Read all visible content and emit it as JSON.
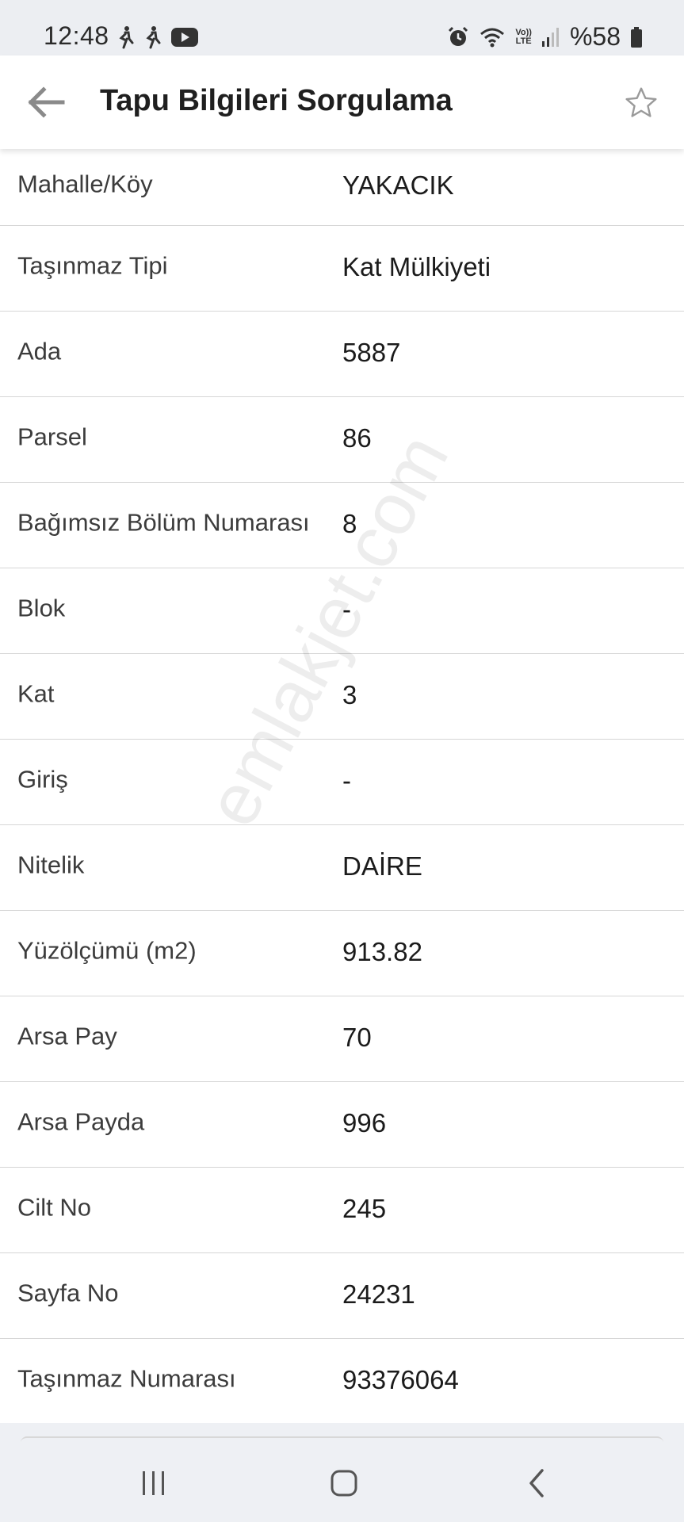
{
  "status_bar": {
    "time": "12:48",
    "battery_percent": "%58",
    "volte_top": "Vo))",
    "volte_bottom": "LTE"
  },
  "app_bar": {
    "title": "Tapu Bilgileri Sorgulama",
    "back_icon": "arrow-left-icon",
    "favorite_icon": "star-outline-icon"
  },
  "rows": [
    {
      "label": "Mahalle/Köy",
      "value": "YAKACIK"
    },
    {
      "label": "Taşınmaz Tipi",
      "value": "Kat Mülkiyeti"
    },
    {
      "label": "Ada",
      "value": "5887"
    },
    {
      "label": "Parsel",
      "value": "86"
    },
    {
      "label": "Bağımsız Bölüm Numarası",
      "value": "8"
    },
    {
      "label": "Blok",
      "value": "-"
    },
    {
      "label": "Kat",
      "value": "3"
    },
    {
      "label": "Giriş",
      "value": "-"
    },
    {
      "label": "Nitelik",
      "value": "DAİRE"
    },
    {
      "label": "Yüzölçümü (m2)",
      "value": "913.82"
    },
    {
      "label": "Arsa Pay",
      "value": "70"
    },
    {
      "label": "Arsa Payda",
      "value": "996"
    },
    {
      "label": "Cilt No",
      "value": "245"
    },
    {
      "label": "Sayfa No",
      "value": "24231"
    },
    {
      "label": "Taşınmaz Numarası",
      "value": "93376064"
    }
  ],
  "watermark": "emlakjet.com",
  "colors": {
    "status_bar_bg": "#eceef2",
    "divider": "#d6d6d6",
    "icon_gray": "#8a8a8a"
  }
}
